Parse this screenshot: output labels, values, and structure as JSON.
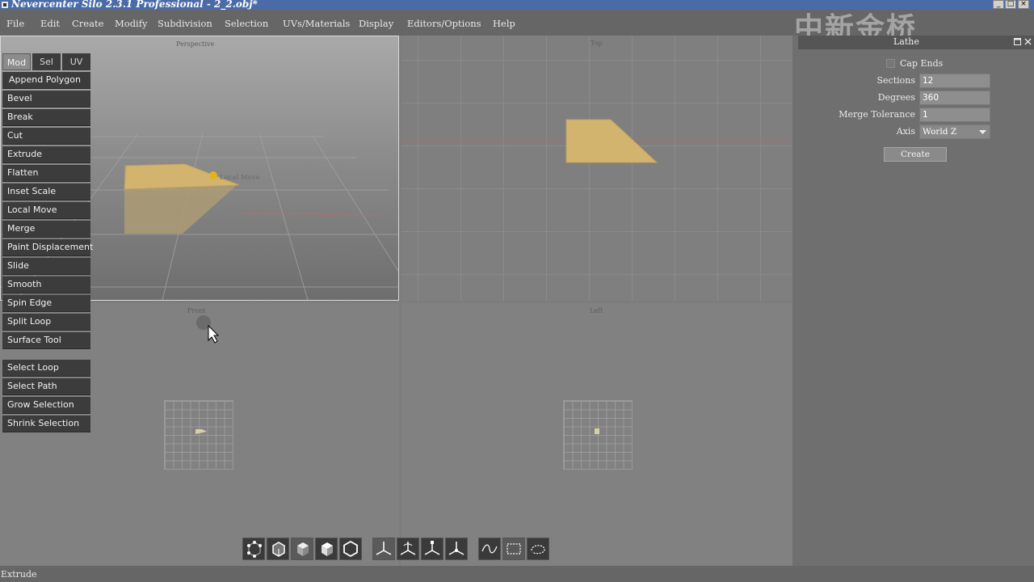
{
  "window": {
    "title": "Nevercenter Silo 2.3.1 Professional - 2_2.obj*",
    "controls": [
      "_",
      "□",
      "×"
    ]
  },
  "menu": [
    "File",
    "Edit",
    "Create",
    "Modify",
    "Subdivision",
    "Selection",
    "UVs/Materials",
    "Display",
    "Editors/Options",
    "Help"
  ],
  "watermark": "中新金桥",
  "viewports": {
    "perspective": {
      "label": "Perspective",
      "overlay_text": "Local Move"
    },
    "top": {
      "label": "Top"
    },
    "front": {
      "label": "Front"
    },
    "left": {
      "label": "Left"
    }
  },
  "tool_tabs": [
    "Mod",
    "Sel",
    "UV"
  ],
  "active_tab": "Mod",
  "modify_tools": [
    "Append Polygon",
    "Bevel",
    "Break",
    "Cut",
    "Extrude",
    "Flatten",
    "Inset Scale",
    "Local Move",
    "Merge",
    "Paint Displacement",
    "Slide",
    "Smooth",
    "Spin Edge",
    "Split Loop",
    "Surface Tool"
  ],
  "selection_tools": [
    "Select Loop",
    "Select Path",
    "Grow Selection",
    "Shrink Selection"
  ],
  "lathe_panel": {
    "title": "Lathe",
    "cap_ends_label": "Cap Ends",
    "cap_ends_checked": false,
    "sections_label": "Sections",
    "sections_value": "12",
    "degrees_label": "Degrees",
    "degrees_value": "360",
    "merge_tolerance_label": "Merge Tolerance",
    "merge_tolerance_value": "1",
    "axis_label": "Axis",
    "axis_value": "World Z",
    "create_button": "Create"
  },
  "bottom_toolbar": {
    "selection_mode_icons": [
      "vertex-mode-icon",
      "edge-mode-icon",
      "face-mode-icon",
      "object-mode-icon",
      "hexagon-mode-icon"
    ],
    "manipulator_icons": [
      "move-manipulator-icon",
      "rotate-manipulator-icon",
      "scale-manipulator-icon",
      "universal-manipulator-icon"
    ],
    "select_style_icons": [
      "paint-select-icon",
      "marquee-select-icon",
      "lasso-select-icon"
    ]
  },
  "status_text": "Extrude",
  "colors": {
    "model_fill": "#d2b46e",
    "tool_button_bg": "#3c3c3c",
    "menubar_bg": "#666666",
    "active_tab_bg": "#8c8c8c"
  }
}
